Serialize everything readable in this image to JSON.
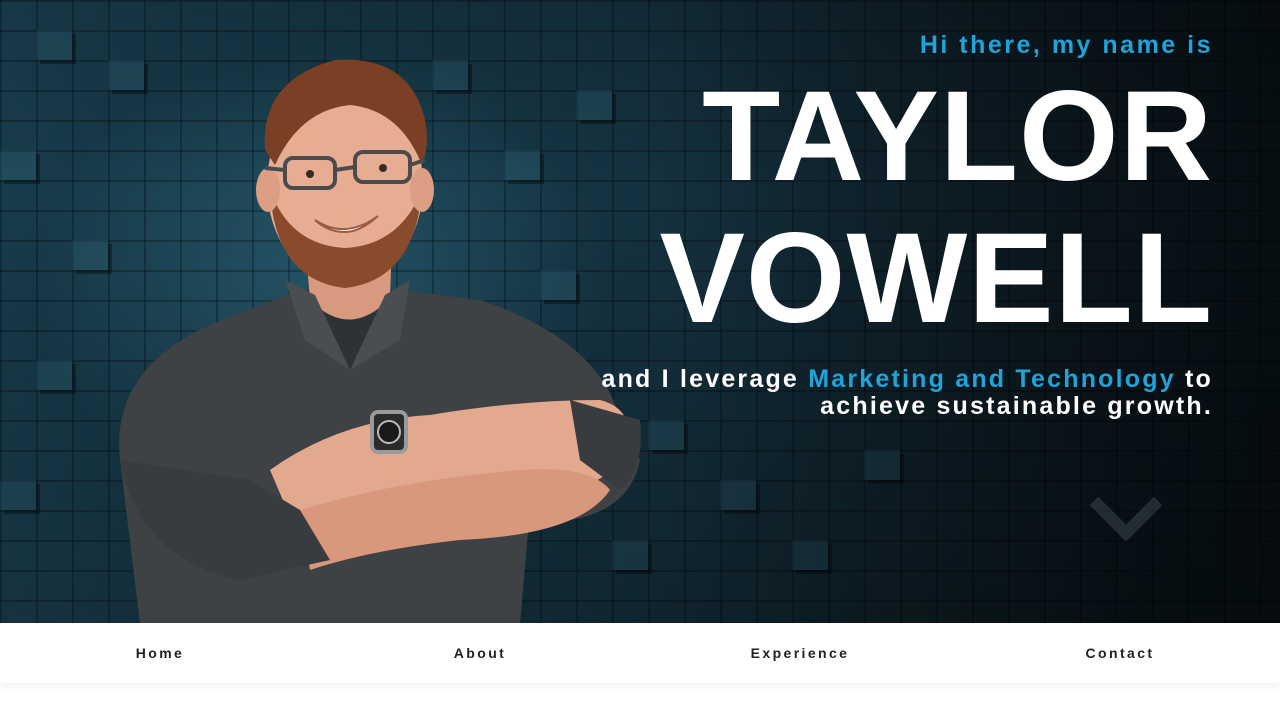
{
  "hero": {
    "greeting": "Hi there, my name is",
    "first_name": "TAYLOR",
    "last_name": "VOWELL",
    "tagline_pre": "and I leverage ",
    "tagline_accent": "Marketing and Technology",
    "tagline_post": " to achieve sustainable growth.",
    "scroll_icon": "chevron-down-icon"
  },
  "nav": {
    "items": [
      {
        "label": "Home"
      },
      {
        "label": "About"
      },
      {
        "label": "Experience"
      },
      {
        "label": "Contact"
      }
    ]
  },
  "colors": {
    "accent": "#1fa3d8",
    "text_light": "#ffffff",
    "nav_text": "#222222",
    "hero_bg": "#193a49"
  }
}
